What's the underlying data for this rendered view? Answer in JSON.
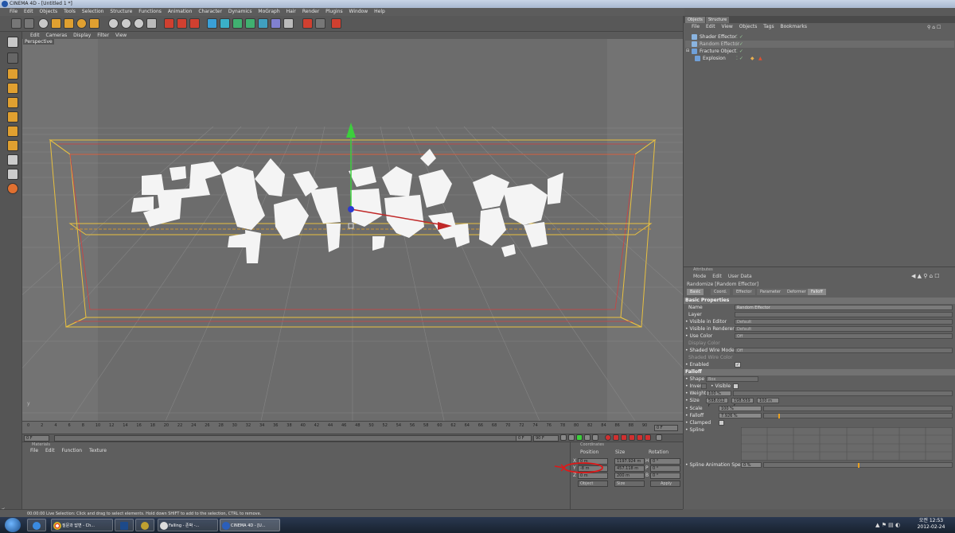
{
  "window": {
    "title": "CINEMA 4D - [Untitled 1 *]"
  },
  "menu": [
    "File",
    "Edit",
    "Objects",
    "Tools",
    "Selection",
    "Structure",
    "Functions",
    "Animation",
    "Character",
    "Dynamics",
    "MoGraph",
    "Hair",
    "Render",
    "Plugins",
    "Window",
    "Help"
  ],
  "viewport": {
    "menu": [
      "Edit",
      "Cameras",
      "Display",
      "Filter",
      "View"
    ],
    "label": "Perspective"
  },
  "timeline": {
    "ticks": [
      "0",
      "2",
      "4",
      "6",
      "8",
      "10",
      "12",
      "14",
      "16",
      "18",
      "20",
      "22",
      "24",
      "26",
      "28",
      "30",
      "32",
      "34",
      "36",
      "38",
      "40",
      "42",
      "44",
      "46",
      "48",
      "50",
      "52",
      "54",
      "56",
      "58",
      "60",
      "62",
      "64",
      "66",
      "68",
      "70",
      "72",
      "74",
      "76",
      "78",
      "80",
      "82",
      "84",
      "86",
      "88",
      "90"
    ],
    "end_frame": "0 F",
    "current_frame": "0 F",
    "start_field": "0 F",
    "end_field": "90 F"
  },
  "materials": {
    "title": "Materials",
    "menu": [
      "File",
      "Edit",
      "Function",
      "Texture"
    ]
  },
  "coordinates": {
    "title": "Coordinates",
    "headers": [
      "Position",
      "Size",
      "Rotation"
    ],
    "rows": [
      {
        "axis": "X",
        "pos": "0 m",
        "size": "1197.924 m",
        "rot_axis": "H",
        "rot": "0 °"
      },
      {
        "axis": "Y",
        "pos": "-8 m",
        "size": "457.118 m",
        "rot_axis": "P",
        "rot": "0 °"
      },
      {
        "axis": "Z",
        "pos": "0 m",
        "size": "200 m",
        "rot_axis": "B",
        "rot": "0 °"
      }
    ],
    "mode1": "Object",
    "mode2": "Size",
    "apply": "Apply"
  },
  "objects_panel": {
    "tabs": [
      "Objects",
      "Structure"
    ],
    "menu": [
      "File",
      "Edit",
      "View",
      "Objects",
      "Tags",
      "Bookmarks"
    ],
    "items": [
      {
        "name": "Shader Effector",
        "indent": 1
      },
      {
        "name": "Random Effector",
        "indent": 1
      },
      {
        "name": "Fracture Object",
        "indent": 0
      },
      {
        "name": "Explosion",
        "indent": 1
      }
    ]
  },
  "attributes": {
    "title": "Attributes",
    "menu": [
      "Mode",
      "Edit",
      "User Data"
    ],
    "object_title": "Randomize [Random Effector]",
    "tabs": [
      "Basic",
      "Coord.",
      "Effector",
      "Parameter",
      "Deformer",
      "Falloff"
    ],
    "basic_header": "Basic Properties",
    "basic": [
      {
        "label": "Name",
        "value": "Random Effector"
      },
      {
        "label": "Layer",
        "value": ""
      },
      {
        "label": "Visible in Editor",
        "value": "Default"
      },
      {
        "label": "Visible in Renderer",
        "value": "Default"
      },
      {
        "label": "Use Color",
        "value": "Off"
      },
      {
        "label": "Display Color",
        "value": ""
      },
      {
        "label": "Shaded Wire Mode",
        "value": "Off"
      },
      {
        "label": "Shaded Wire Color",
        "value": ""
      },
      {
        "label": "Enabled",
        "value": "✓"
      }
    ],
    "falloff_header": "Falloff",
    "shape_label": "Shape",
    "shape_value": "Box",
    "invert_label": "Invert",
    "visible_label": "Visible",
    "weight_label": "Weight",
    "weight_value": "100 %",
    "size_label": "Size",
    "size_values": [
      "598.012 r",
      "198.559 r",
      "100 m"
    ],
    "scale_label": "Scale",
    "scale_value": "100 %",
    "falloff_label": "Falloff",
    "falloff_value": "7.926 %",
    "clamped_label": "Clamped",
    "spline_label": "Spline",
    "spline_speed_label": "Spline Animation Speed",
    "spline_speed_value": "0 %"
  },
  "status": {
    "text": "00:00:00   Live Selection: Click and drag to select elements. Hold down SHIFT to add to the selection, CTRL to remove."
  },
  "taskbar": {
    "items": [
      "질문과 답변 - Ch...",
      "",
      "",
      "Falling - 존박 -...",
      "CINEMA 4D - [U..."
    ],
    "time": "오전 12:53",
    "date": "2012-02-24"
  },
  "side_brand": "MAXON CINEMA 4D"
}
